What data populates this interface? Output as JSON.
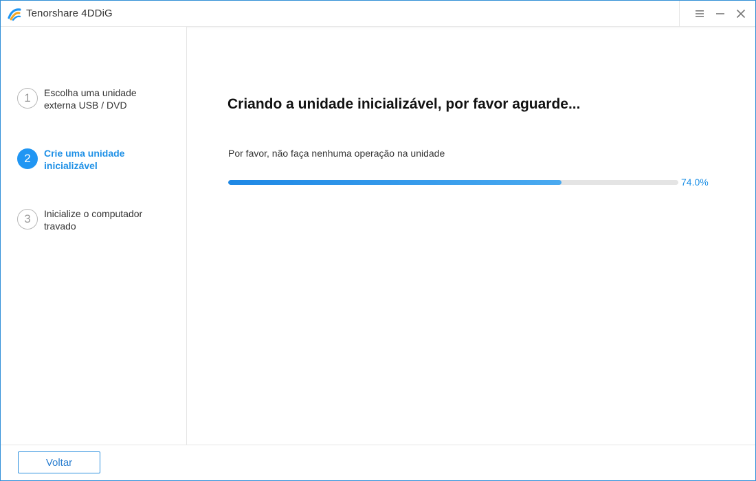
{
  "app": {
    "title": "Tenorshare 4DDiG",
    "logo_icon": "tenorshare-logo-icon"
  },
  "window_controls": {
    "menu_icon": "hamburger-menu-icon",
    "minimize_icon": "minimize-icon",
    "close_icon": "close-icon"
  },
  "sidebar": {
    "steps": [
      {
        "number": "1",
        "label": "Escolha uma unidade externa USB / DVD",
        "active": false
      },
      {
        "number": "2",
        "label": "Crie uma unidade inicializável",
        "active": true
      },
      {
        "number": "3",
        "label": "Inicialize o computador travado",
        "active": false
      }
    ]
  },
  "main": {
    "title": "Criando a unidade inicializável, por favor aguarde...",
    "subtitle": "Por favor, não faça nenhuma operação na unidade",
    "progress": {
      "value": 0.74,
      "label": "74.0%"
    }
  },
  "footer": {
    "back_label": "Voltar"
  },
  "colors": {
    "accent": "#2196f3",
    "accent_text": "#1e90e6",
    "window_border": "#2f8fd8",
    "track": "#e4e4e4"
  }
}
